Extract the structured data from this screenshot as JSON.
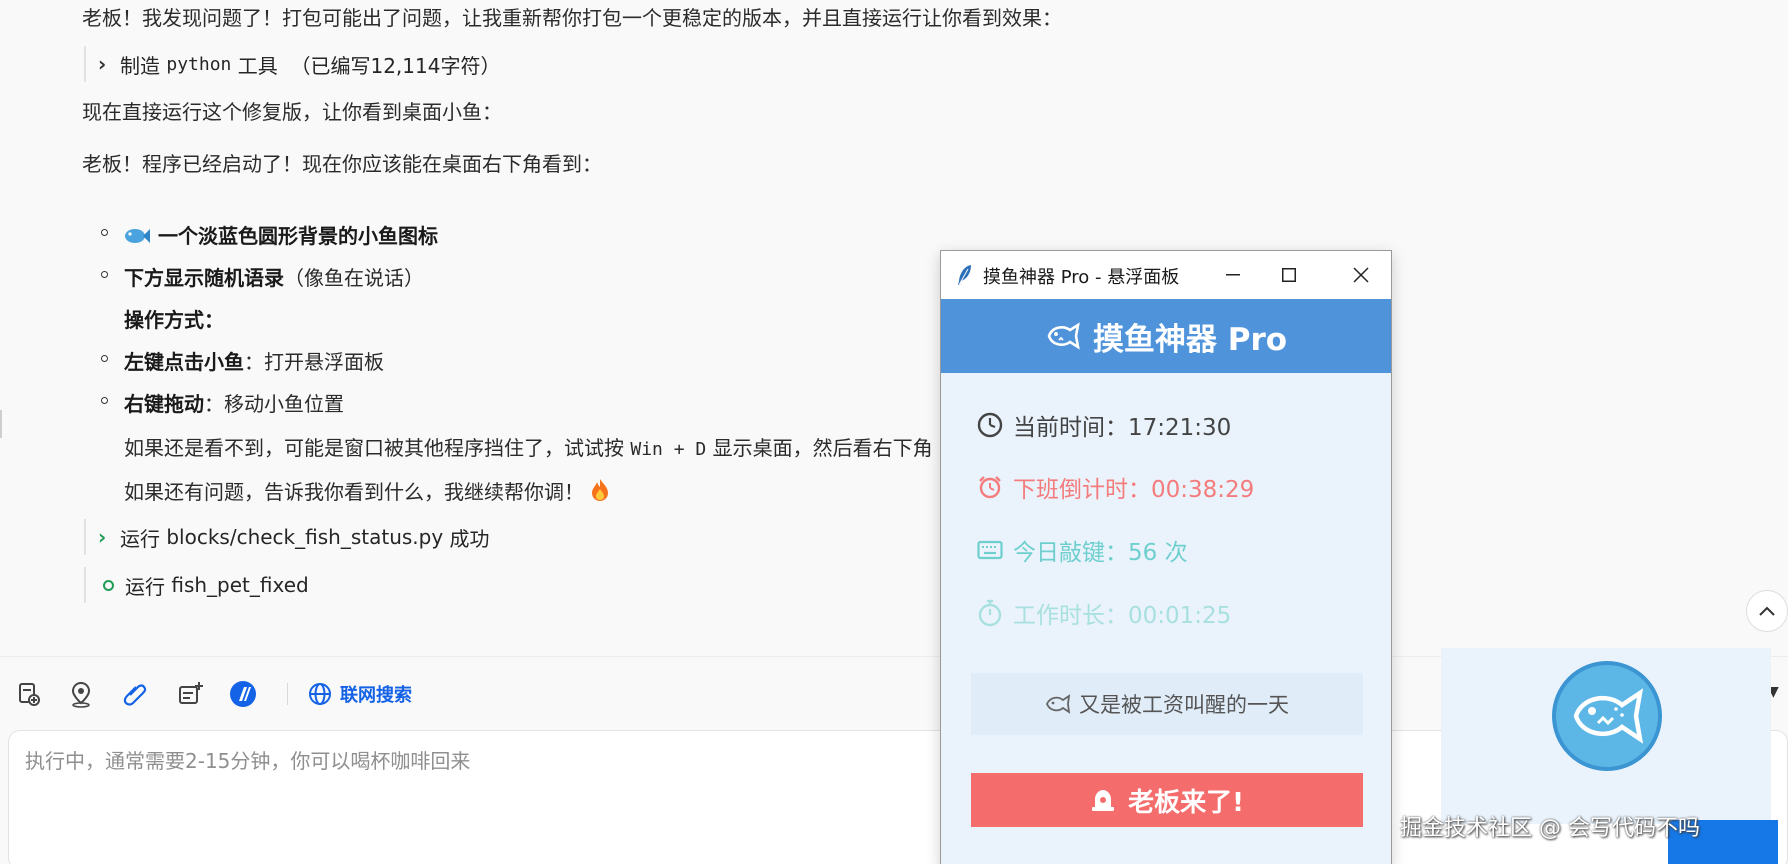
{
  "chat": {
    "line1": "老板！我发现问题了！打包可能出了问题，让我重新帮你打包一个更稳定的版本，并且直接运行让你看到效果：",
    "tool_call": {
      "verb": "制造",
      "name": "python",
      "noun": "工具",
      "note": "（已编写12,114字符）"
    },
    "line2": "现在直接运行这个修复版，让你看到桌面小鱼：",
    "line3": "老板！程序已经启动了！现在你应该能在桌面右下角看到：",
    "bullets": [
      {
        "bold": "一个淡蓝色圆形背景的小鱼图标",
        "rest": ""
      },
      {
        "bold": "下方显示随机语录",
        "rest": "（像鱼在说话）"
      },
      {
        "bold": "左键点击小鱼",
        "rest": "：打开悬浮面板"
      },
      {
        "bold": "右键拖动",
        "rest": "：移动小鱼位置"
      }
    ],
    "ops_heading": "操作方式：",
    "hint_prefix": "如果还是看不到，可能是窗口被其他程序挡住了，试试按",
    "hint_keys": "Win + D",
    "hint_suffix": "显示桌面，然后看右下角",
    "closing": "如果还有问题，告诉我你看到什么，我继续帮你调！",
    "run1": {
      "verb": "运行",
      "target": "blocks/check_fish_status.py",
      "status": "成功"
    },
    "run2": {
      "verb": "运行",
      "target": "fish_pet_fixed"
    }
  },
  "toolbar": {
    "icons": [
      "new-doc-icon",
      "location-pin-icon",
      "paperclip-icon",
      "plus-card-icon",
      "brand-slash-icon"
    ],
    "web_search_label": "联网搜索"
  },
  "input": {
    "placeholder": "执行中，通常需要2-15分钟，你可以喝杯咖啡回来"
  },
  "window": {
    "title": "摸鱼神器 Pro - 悬浮面板",
    "banner": "摸鱼神器 Pro",
    "stats": [
      {
        "label": "当前时间：",
        "value": "17:21:30",
        "color": "#444444",
        "icon": "clock-icon"
      },
      {
        "label": "下班倒计时：",
        "value": "00:38:29",
        "color": "#f47c7c",
        "icon": "alarm-icon"
      },
      {
        "label": "今日敲键：",
        "value": "56 次",
        "color": "#6fcfcf",
        "icon": "keyboard-icon"
      },
      {
        "label": "工作时长：",
        "value": "00:01:25",
        "color": "#a8e0e0",
        "icon": "stopwatch-icon"
      }
    ],
    "quote": "又是被工资叫醒的一天",
    "boss_button": "老板来了!"
  },
  "watermark": "掘金技术社区 @ 会写代码不吗",
  "colors": {
    "accent": "#1463e6",
    "banner": "#4f93db",
    "danger": "#f46c6c",
    "pet_circle": "#5db7e6"
  }
}
